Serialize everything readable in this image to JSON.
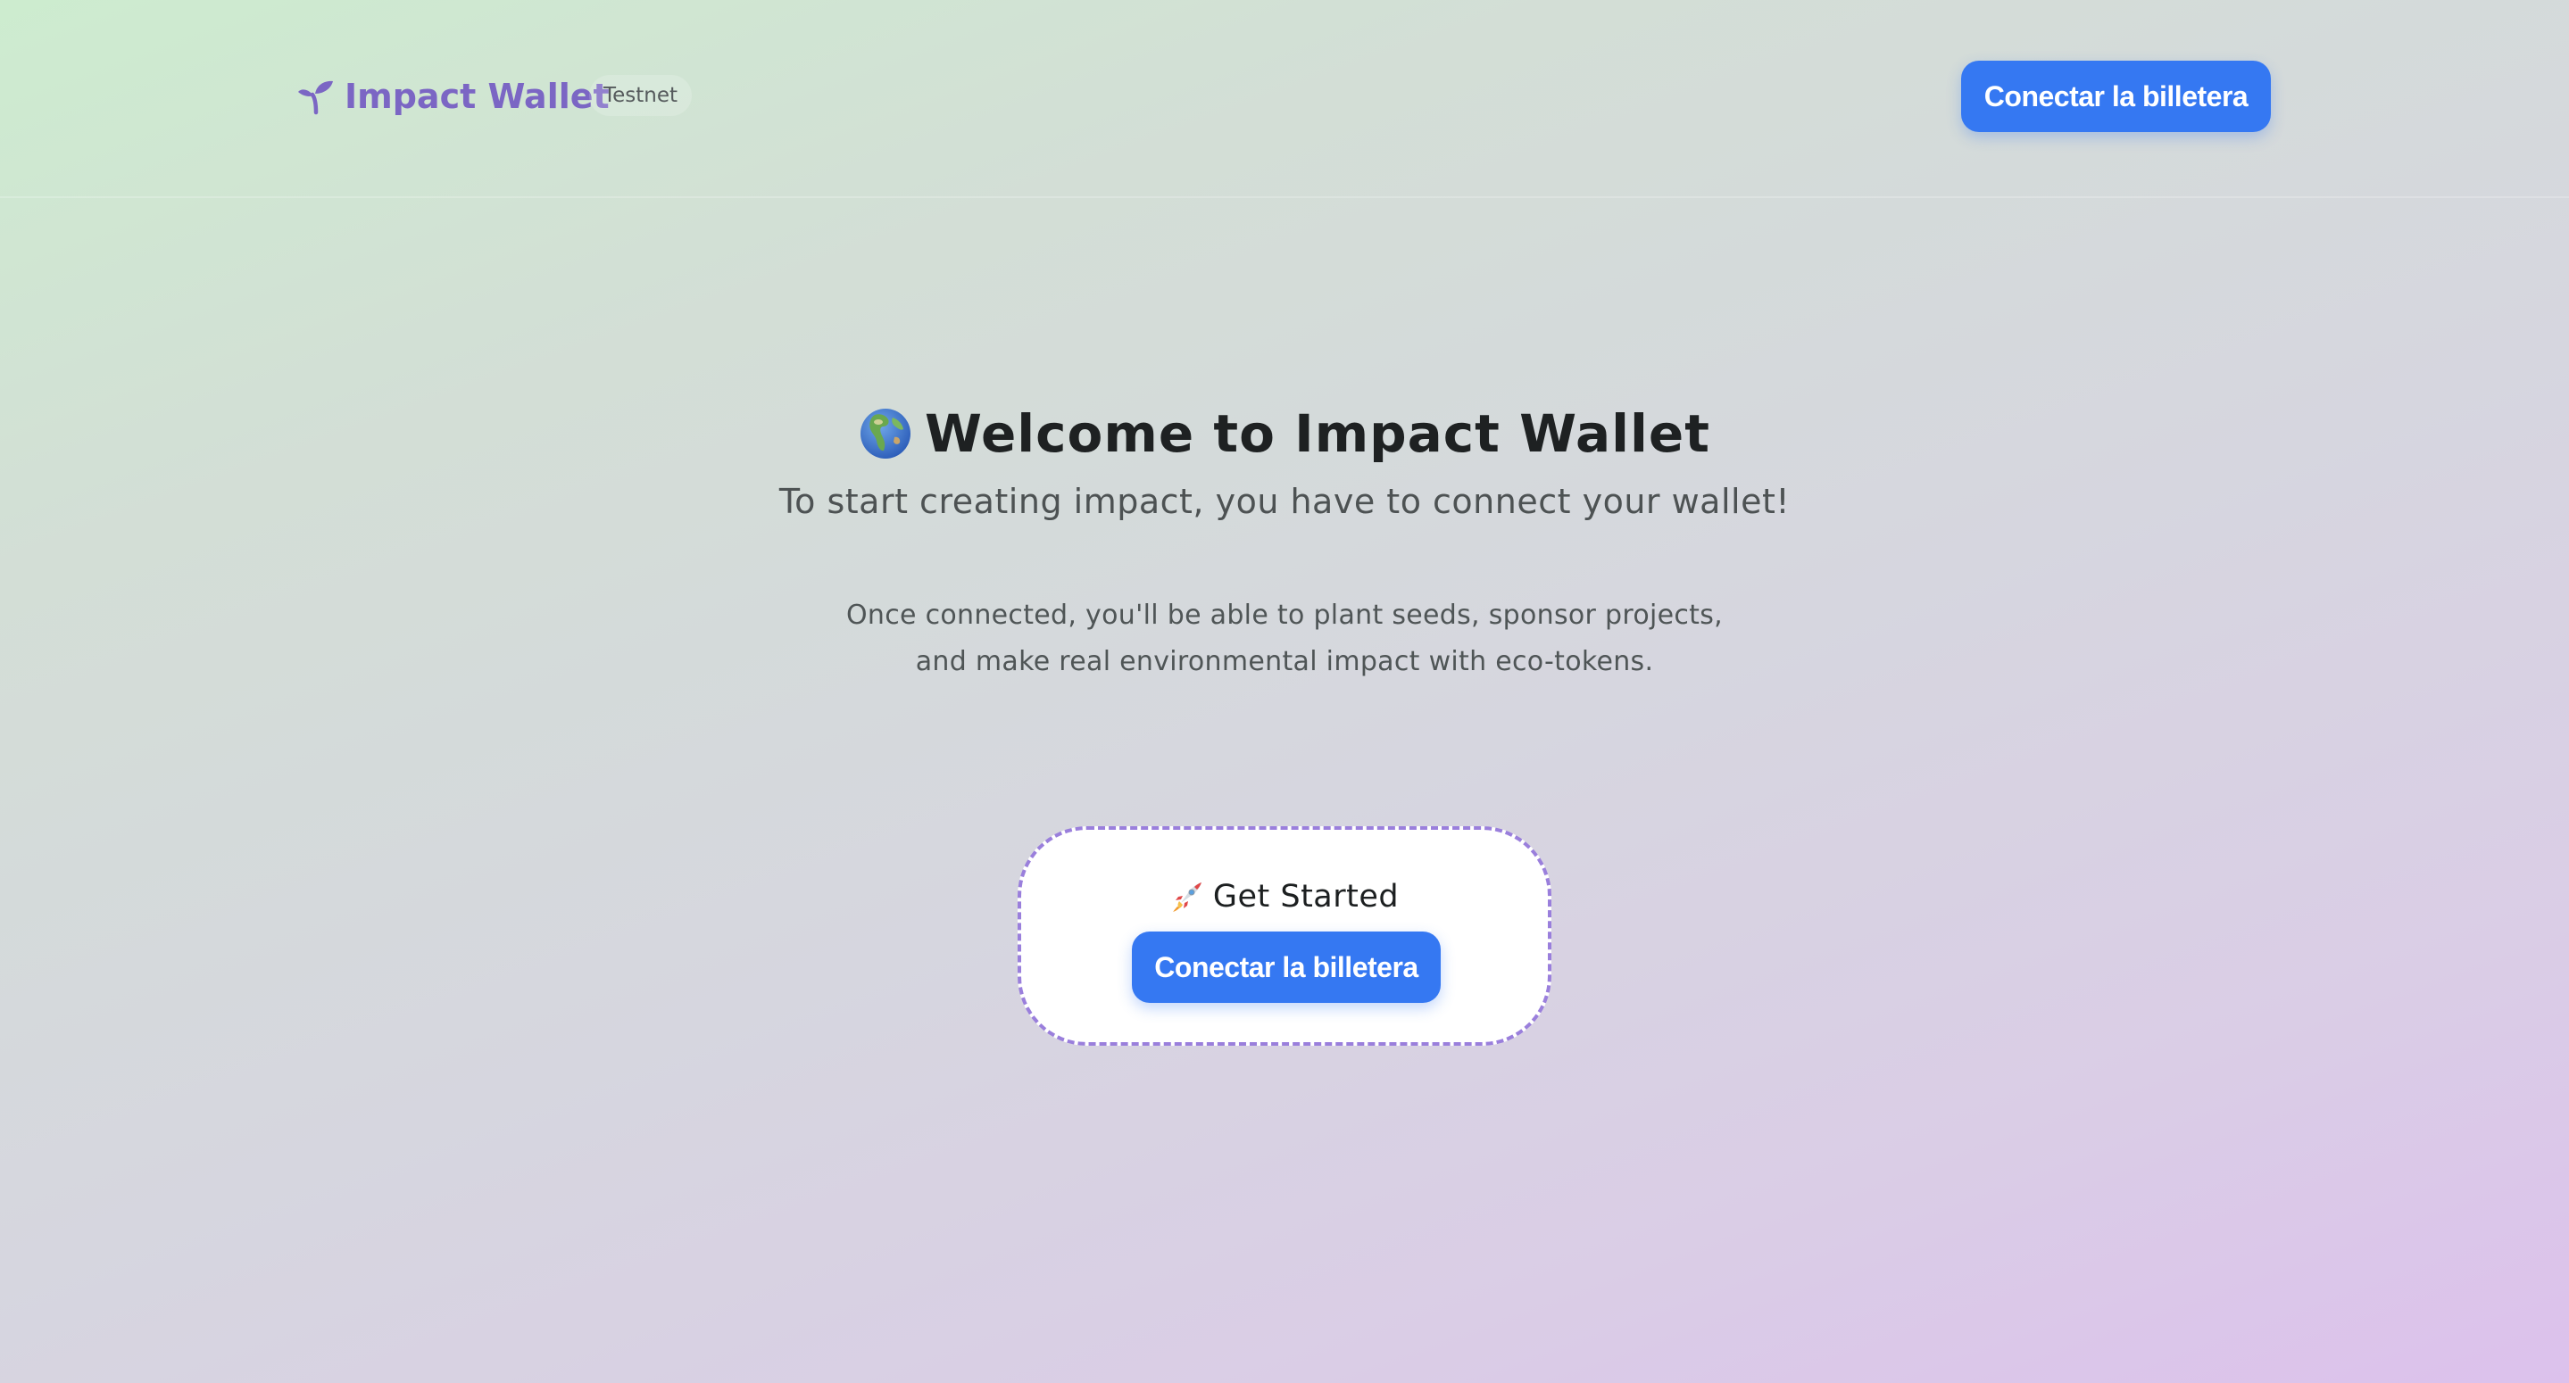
{
  "header": {
    "brand_name": "Impact Wallet",
    "network_badge": "Testnet",
    "connect_button": "Conectar la billetera"
  },
  "hero": {
    "title": "Welcome to Impact Wallet",
    "subtitle": "To start creating impact, you have to connect your wallet!",
    "description": "Once connected, you'll be able to plant seeds, sponsor projects, and make real environmental impact with eco-tokens."
  },
  "start_card": {
    "heading": "Get Started",
    "connect_button": "Conectar la billetera"
  },
  "icons": {
    "brand": "sprout-icon",
    "hero": "globe-icon",
    "start": "rocket-icon"
  },
  "colors": {
    "accent": "#3578f2",
    "brand": "#7b66c4",
    "card_border": "#9a7fdc"
  }
}
